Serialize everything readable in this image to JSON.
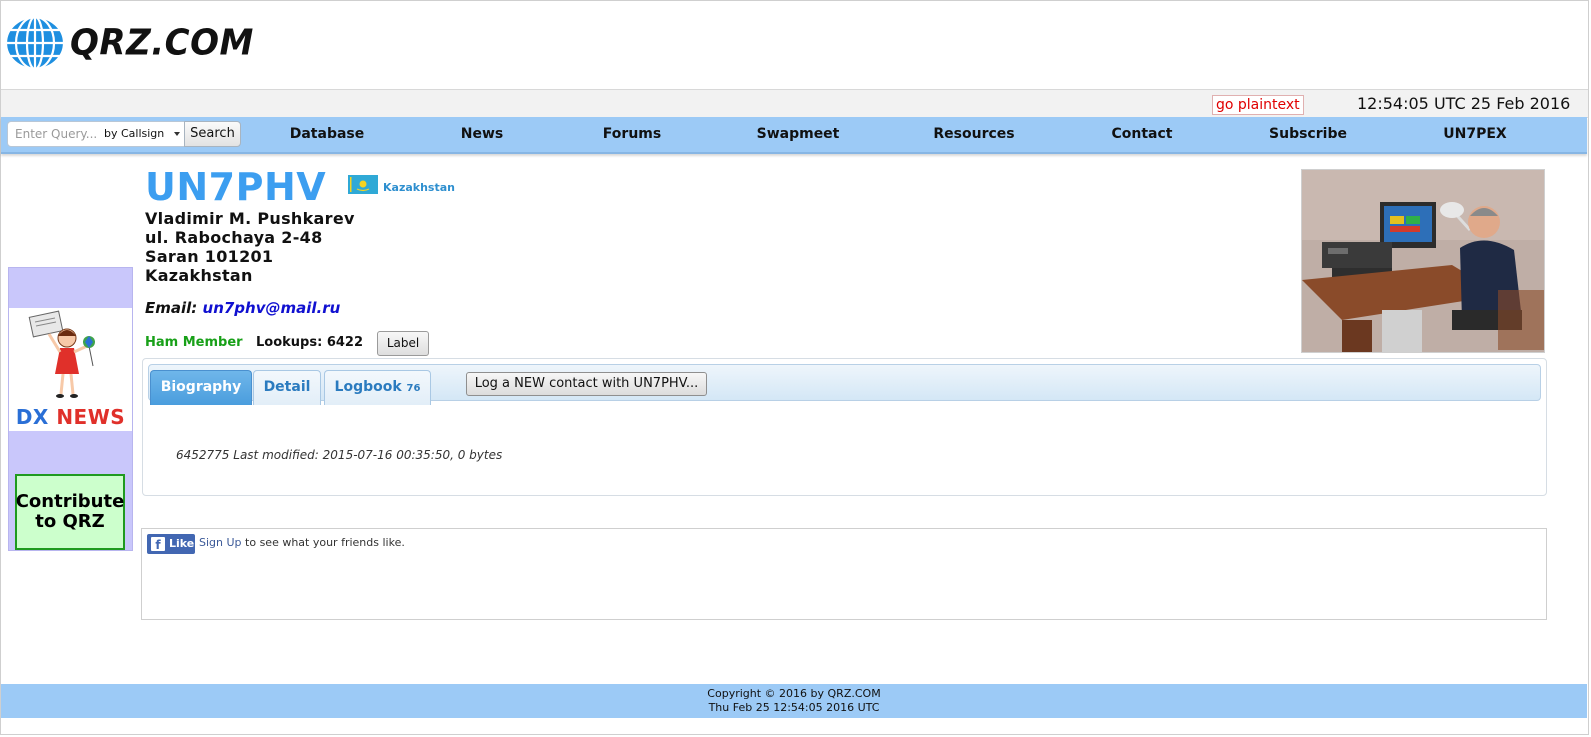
{
  "logo": {
    "text": "QRZ.COM"
  },
  "utilbar": {
    "plaintext_link": "go plaintext",
    "clock": "12:54:05 UTC 25 Feb 2016"
  },
  "search": {
    "placeholder": "Enter Query...",
    "type": "by Callsign",
    "button_label": "Search"
  },
  "nav": {
    "items": [
      {
        "label": "Database"
      },
      {
        "label": "News"
      },
      {
        "label": "Forums"
      },
      {
        "label": "Swapmeet"
      },
      {
        "label": "Resources"
      },
      {
        "label": "Contact"
      },
      {
        "label": "Subscribe"
      },
      {
        "label": "UN7PEX"
      }
    ]
  },
  "sidebar": {
    "dxnews_dx": "DX",
    "dxnews_news": "NEWS",
    "contribute_label": "Contribute to QRZ"
  },
  "profile": {
    "callsign": "UN7PHV",
    "country": "Kazakhstan",
    "name": "Vladimir M. Pushkarev",
    "address": [
      "ul. Rabochaya 2-48",
      "Saran 101201",
      "Kazakhstan"
    ],
    "email_label": "Email:",
    "email": "un7phv@mail.ru",
    "member": "Ham Member",
    "lookups": "Lookups: 6422",
    "label_button": "Label"
  },
  "tabs": {
    "items": [
      {
        "label": "Biography",
        "active": true
      },
      {
        "label": "Detail",
        "active": false
      },
      {
        "label": "Logbook",
        "count": "76",
        "active": false
      }
    ],
    "log_button": "Log a NEW contact with UN7PHV...",
    "modified": "6452775 Last modified: 2015-07-16 00:35:50, 0 bytes"
  },
  "facebook": {
    "like_label": "Like",
    "signup": "Sign Up",
    "text": " to see what your friends like."
  },
  "footer": {
    "copyright": "Copyright © 2016 by QRZ.COM",
    "date": "Thu Feb 25 12:54:05 2016 UTC"
  },
  "colors": {
    "nav_bg": "#9ccaf6",
    "callsign": "#3c9ef0",
    "member": "#18a018",
    "plaintext": "#e00000"
  }
}
